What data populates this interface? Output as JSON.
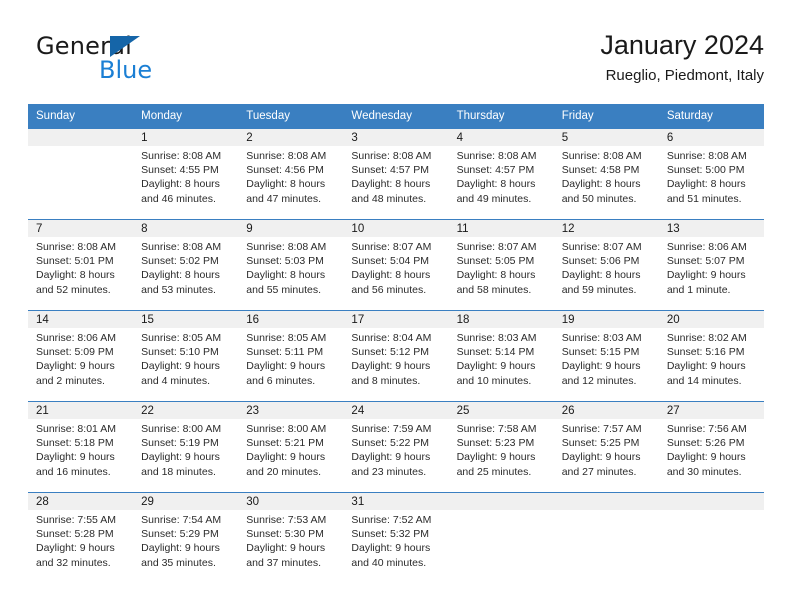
{
  "logo": {
    "word_top": "General",
    "word_bottom": "Blue",
    "triangle_color": "#1565a8",
    "blue_color": "#1b7fd4"
  },
  "header": {
    "title": "January 2024",
    "subtitle": "Rueglio, Piedmont, Italy"
  },
  "theme": {
    "header_row_bg": "#3a7fc1",
    "daynum_band_bg": "#f0f0f0",
    "grid_line": "#3a7fc1",
    "text": "#1a1a1a"
  },
  "weekday_headers": [
    "Sunday",
    "Monday",
    "Tuesday",
    "Wednesday",
    "Thursday",
    "Friday",
    "Saturday"
  ],
  "weeks": [
    [
      {
        "day": "",
        "sunrise": "",
        "sunset": "",
        "daylight1": "",
        "daylight2": ""
      },
      {
        "day": "1",
        "sunrise": "Sunrise: 8:08 AM",
        "sunset": "Sunset: 4:55 PM",
        "daylight1": "Daylight: 8 hours",
        "daylight2": "and 46 minutes."
      },
      {
        "day": "2",
        "sunrise": "Sunrise: 8:08 AM",
        "sunset": "Sunset: 4:56 PM",
        "daylight1": "Daylight: 8 hours",
        "daylight2": "and 47 minutes."
      },
      {
        "day": "3",
        "sunrise": "Sunrise: 8:08 AM",
        "sunset": "Sunset: 4:57 PM",
        "daylight1": "Daylight: 8 hours",
        "daylight2": "and 48 minutes."
      },
      {
        "day": "4",
        "sunrise": "Sunrise: 8:08 AM",
        "sunset": "Sunset: 4:57 PM",
        "daylight1": "Daylight: 8 hours",
        "daylight2": "and 49 minutes."
      },
      {
        "day": "5",
        "sunrise": "Sunrise: 8:08 AM",
        "sunset": "Sunset: 4:58 PM",
        "daylight1": "Daylight: 8 hours",
        "daylight2": "and 50 minutes."
      },
      {
        "day": "6",
        "sunrise": "Sunrise: 8:08 AM",
        "sunset": "Sunset: 5:00 PM",
        "daylight1": "Daylight: 8 hours",
        "daylight2": "and 51 minutes."
      }
    ],
    [
      {
        "day": "7",
        "sunrise": "Sunrise: 8:08 AM",
        "sunset": "Sunset: 5:01 PM",
        "daylight1": "Daylight: 8 hours",
        "daylight2": "and 52 minutes."
      },
      {
        "day": "8",
        "sunrise": "Sunrise: 8:08 AM",
        "sunset": "Sunset: 5:02 PM",
        "daylight1": "Daylight: 8 hours",
        "daylight2": "and 53 minutes."
      },
      {
        "day": "9",
        "sunrise": "Sunrise: 8:08 AM",
        "sunset": "Sunset: 5:03 PM",
        "daylight1": "Daylight: 8 hours",
        "daylight2": "and 55 minutes."
      },
      {
        "day": "10",
        "sunrise": "Sunrise: 8:07 AM",
        "sunset": "Sunset: 5:04 PM",
        "daylight1": "Daylight: 8 hours",
        "daylight2": "and 56 minutes."
      },
      {
        "day": "11",
        "sunrise": "Sunrise: 8:07 AM",
        "sunset": "Sunset: 5:05 PM",
        "daylight1": "Daylight: 8 hours",
        "daylight2": "and 58 minutes."
      },
      {
        "day": "12",
        "sunrise": "Sunrise: 8:07 AM",
        "sunset": "Sunset: 5:06 PM",
        "daylight1": "Daylight: 8 hours",
        "daylight2": "and 59 minutes."
      },
      {
        "day": "13",
        "sunrise": "Sunrise: 8:06 AM",
        "sunset": "Sunset: 5:07 PM",
        "daylight1": "Daylight: 9 hours",
        "daylight2": "and 1 minute."
      }
    ],
    [
      {
        "day": "14",
        "sunrise": "Sunrise: 8:06 AM",
        "sunset": "Sunset: 5:09 PM",
        "daylight1": "Daylight: 9 hours",
        "daylight2": "and 2 minutes."
      },
      {
        "day": "15",
        "sunrise": "Sunrise: 8:05 AM",
        "sunset": "Sunset: 5:10 PM",
        "daylight1": "Daylight: 9 hours",
        "daylight2": "and 4 minutes."
      },
      {
        "day": "16",
        "sunrise": "Sunrise: 8:05 AM",
        "sunset": "Sunset: 5:11 PM",
        "daylight1": "Daylight: 9 hours",
        "daylight2": "and 6 minutes."
      },
      {
        "day": "17",
        "sunrise": "Sunrise: 8:04 AM",
        "sunset": "Sunset: 5:12 PM",
        "daylight1": "Daylight: 9 hours",
        "daylight2": "and 8 minutes."
      },
      {
        "day": "18",
        "sunrise": "Sunrise: 8:03 AM",
        "sunset": "Sunset: 5:14 PM",
        "daylight1": "Daylight: 9 hours",
        "daylight2": "and 10 minutes."
      },
      {
        "day": "19",
        "sunrise": "Sunrise: 8:03 AM",
        "sunset": "Sunset: 5:15 PM",
        "daylight1": "Daylight: 9 hours",
        "daylight2": "and 12 minutes."
      },
      {
        "day": "20",
        "sunrise": "Sunrise: 8:02 AM",
        "sunset": "Sunset: 5:16 PM",
        "daylight1": "Daylight: 9 hours",
        "daylight2": "and 14 minutes."
      }
    ],
    [
      {
        "day": "21",
        "sunrise": "Sunrise: 8:01 AM",
        "sunset": "Sunset: 5:18 PM",
        "daylight1": "Daylight: 9 hours",
        "daylight2": "and 16 minutes."
      },
      {
        "day": "22",
        "sunrise": "Sunrise: 8:00 AM",
        "sunset": "Sunset: 5:19 PM",
        "daylight1": "Daylight: 9 hours",
        "daylight2": "and 18 minutes."
      },
      {
        "day": "23",
        "sunrise": "Sunrise: 8:00 AM",
        "sunset": "Sunset: 5:21 PM",
        "daylight1": "Daylight: 9 hours",
        "daylight2": "and 20 minutes."
      },
      {
        "day": "24",
        "sunrise": "Sunrise: 7:59 AM",
        "sunset": "Sunset: 5:22 PM",
        "daylight1": "Daylight: 9 hours",
        "daylight2": "and 23 minutes."
      },
      {
        "day": "25",
        "sunrise": "Sunrise: 7:58 AM",
        "sunset": "Sunset: 5:23 PM",
        "daylight1": "Daylight: 9 hours",
        "daylight2": "and 25 minutes."
      },
      {
        "day": "26",
        "sunrise": "Sunrise: 7:57 AM",
        "sunset": "Sunset: 5:25 PM",
        "daylight1": "Daylight: 9 hours",
        "daylight2": "and 27 minutes."
      },
      {
        "day": "27",
        "sunrise": "Sunrise: 7:56 AM",
        "sunset": "Sunset: 5:26 PM",
        "daylight1": "Daylight: 9 hours",
        "daylight2": "and 30 minutes."
      }
    ],
    [
      {
        "day": "28",
        "sunrise": "Sunrise: 7:55 AM",
        "sunset": "Sunset: 5:28 PM",
        "daylight1": "Daylight: 9 hours",
        "daylight2": "and 32 minutes."
      },
      {
        "day": "29",
        "sunrise": "Sunrise: 7:54 AM",
        "sunset": "Sunset: 5:29 PM",
        "daylight1": "Daylight: 9 hours",
        "daylight2": "and 35 minutes."
      },
      {
        "day": "30",
        "sunrise": "Sunrise: 7:53 AM",
        "sunset": "Sunset: 5:30 PM",
        "daylight1": "Daylight: 9 hours",
        "daylight2": "and 37 minutes."
      },
      {
        "day": "31",
        "sunrise": "Sunrise: 7:52 AM",
        "sunset": "Sunset: 5:32 PM",
        "daylight1": "Daylight: 9 hours",
        "daylight2": "and 40 minutes."
      },
      {
        "day": "",
        "sunrise": "",
        "sunset": "",
        "daylight1": "",
        "daylight2": ""
      },
      {
        "day": "",
        "sunrise": "",
        "sunset": "",
        "daylight1": "",
        "daylight2": ""
      },
      {
        "day": "",
        "sunrise": "",
        "sunset": "",
        "daylight1": "",
        "daylight2": ""
      }
    ]
  ]
}
